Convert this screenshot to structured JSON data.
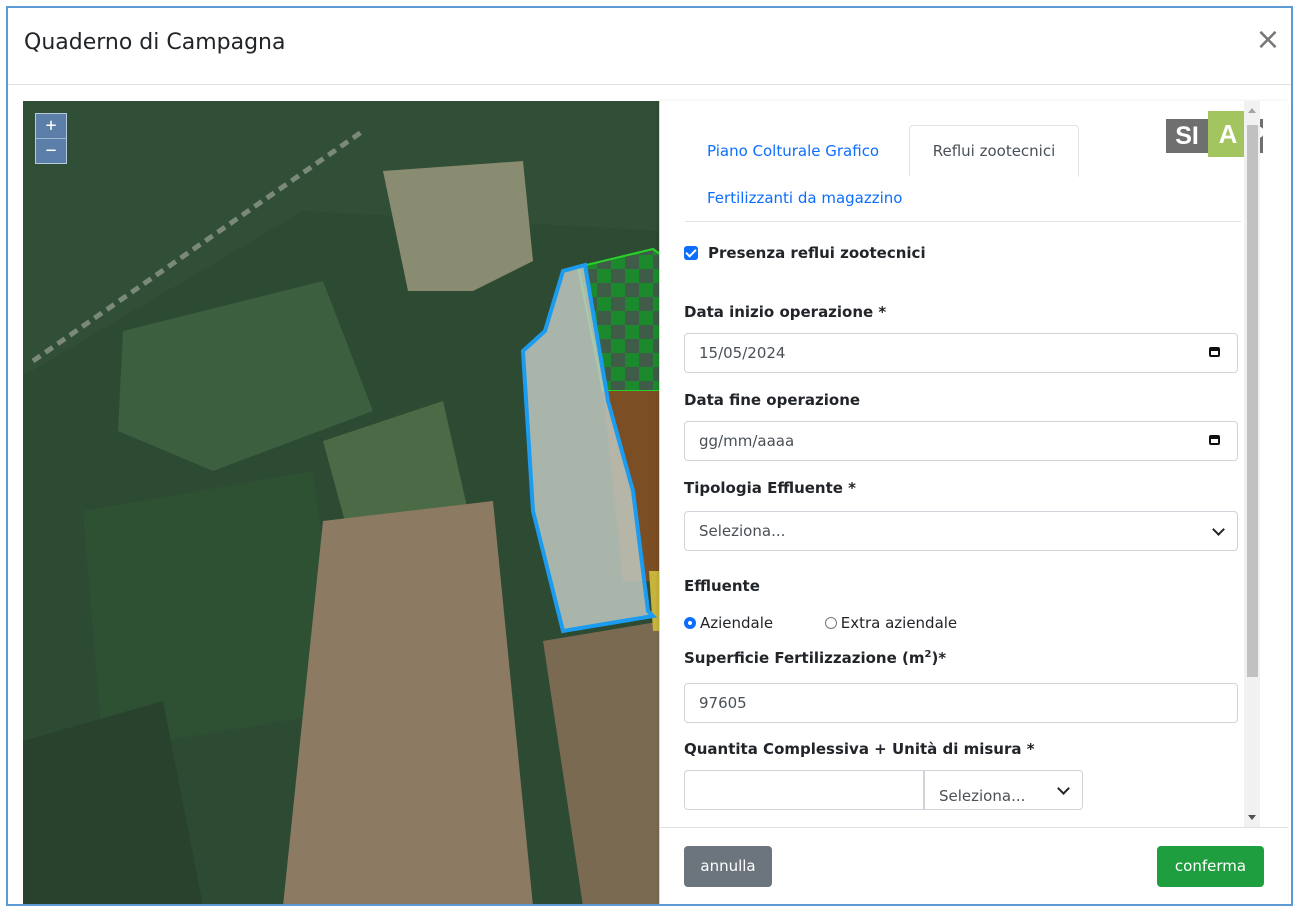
{
  "modal": {
    "title": "Quaderno di Campagna",
    "close_symbol": "×"
  },
  "map": {
    "zoom_in": "+",
    "zoom_out": "−"
  },
  "panel": {
    "tabs": [
      "Piano Colturale Grafico",
      "Reflui zootecnici",
      "Fertilizzanti da magazzino"
    ],
    "active_tab": "Reflui zootecnici",
    "logo": {
      "s": "SI",
      "a": "A",
      "p": "P",
      "colors": {
        "gray": "#6f6f6f",
        "green": "#a3c560"
      }
    },
    "presence_label": "Presenza reflui zootecnici",
    "presence_checked": true,
    "start_label": "Data inizio operazione *",
    "start_value": "15/05/2024",
    "end_label": "Data fine operazione",
    "end_placeholder": "gg/mm/aaaa",
    "type_label": "Tipologia Effluente *",
    "type_value": "Seleziona...",
    "effluent_label": "Effluente",
    "radio_aziendale": "Aziendale",
    "radio_extra": "Extra aziendale",
    "surface_label": "Superficie Fertilizzazione (m",
    "surface_label_sup": "2",
    "surface_label_end": ")*",
    "surface_value": "97605",
    "quantity_label": "Quantita Complessiva + Unità di misura *",
    "unit_value": "Seleziona..."
  },
  "footer": {
    "cancel_label": "annulla",
    "confirm_label": "conferma"
  },
  "colors": {
    "primary": "#0d6efd",
    "success": "#1e9e3e",
    "secondary": "#6c757d",
    "field_outline": "#1c9cf0"
  }
}
